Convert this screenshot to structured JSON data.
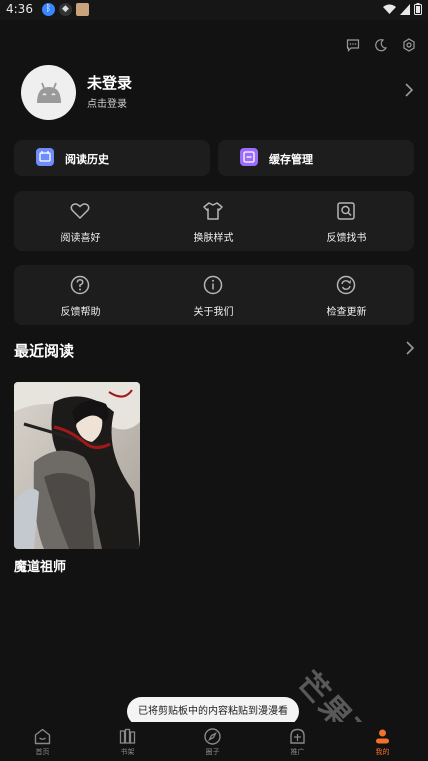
{
  "status_bar": {
    "time": "4:36"
  },
  "top_actions": [
    "message-icon",
    "night-mode-icon",
    "settings-icon"
  ],
  "profile": {
    "name": "未登录",
    "subtitle": "点击登录"
  },
  "quick_actions": [
    {
      "label": "阅读历史",
      "icon": "history-icon",
      "color": "#6f8cff"
    },
    {
      "label": "缓存管理",
      "icon": "cache-icon",
      "color": "#9b6cff"
    }
  ],
  "grid_row_1": [
    {
      "label": "阅读喜好",
      "icon": "heart-icon"
    },
    {
      "label": "换肤样式",
      "icon": "shirt-icon"
    },
    {
      "label": "反馈找书",
      "icon": "search-book-icon"
    }
  ],
  "grid_row_2": [
    {
      "label": "反馈帮助",
      "icon": "help-icon"
    },
    {
      "label": "关于我们",
      "icon": "info-icon"
    },
    {
      "label": "检查更新",
      "icon": "refresh-icon"
    }
  ],
  "recent": {
    "title": "最近阅读",
    "books": [
      {
        "title": "魔道祖师"
      }
    ]
  },
  "toast": "已将剪贴板中的内容粘贴到漫漫看",
  "watermark": "芒果玩",
  "tabs": [
    {
      "label": "首页",
      "icon": "home-icon",
      "active": false
    },
    {
      "label": "书架",
      "icon": "bookshelf-icon",
      "active": false
    },
    {
      "label": "圈子",
      "icon": "compass-icon",
      "active": false
    },
    {
      "label": "推广",
      "icon": "promote-icon",
      "active": false
    },
    {
      "label": "我的",
      "icon": "profile-icon",
      "active": true
    }
  ],
  "colors": {
    "background": "#121212",
    "panel": "#1d1d1d",
    "accent": "#f2712b"
  }
}
